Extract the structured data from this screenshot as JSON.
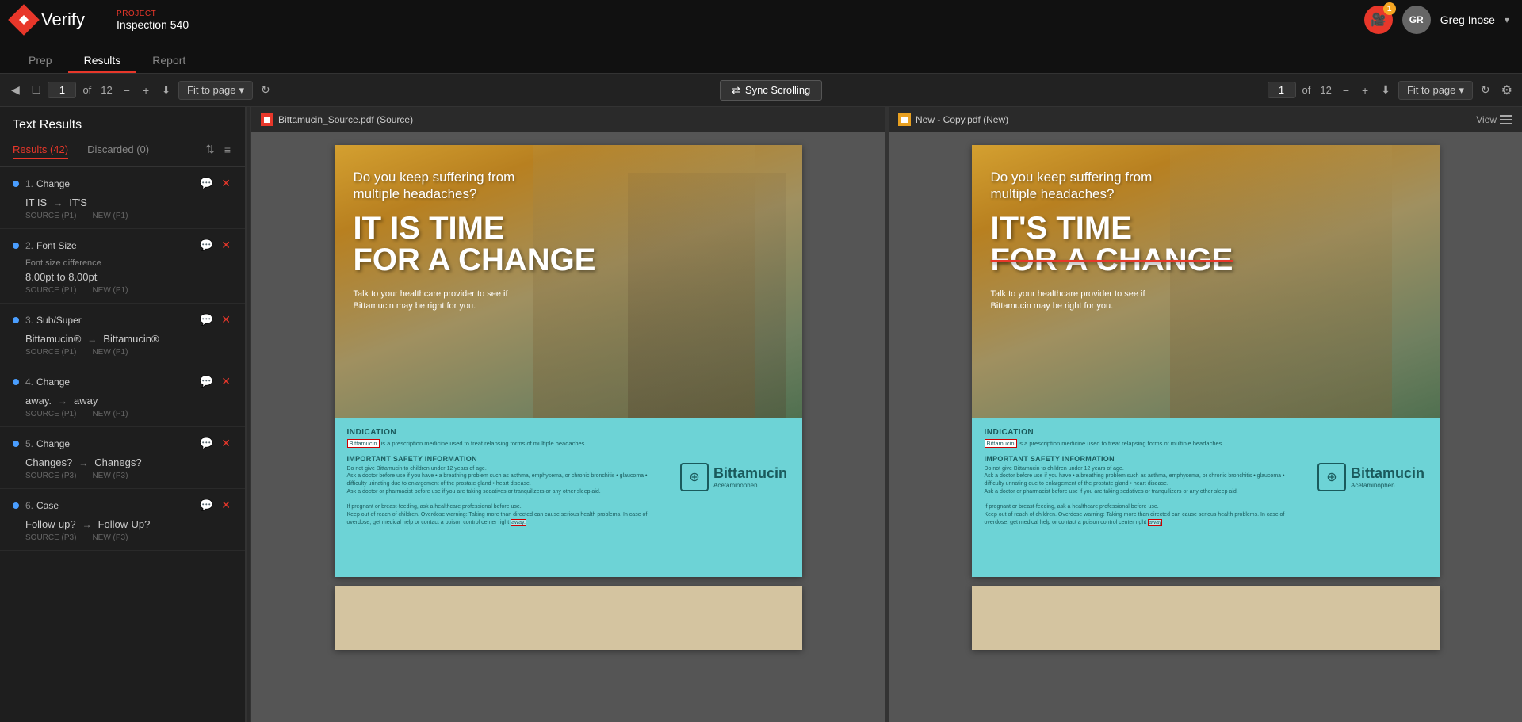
{
  "app": {
    "name": "Verify",
    "logo_alt": "Verify diamond logo"
  },
  "project": {
    "label": "PROJECT",
    "name": "Inspection 540"
  },
  "header": {
    "notification_count": "1",
    "user_initials": "GR",
    "user_name": "Greg Inose"
  },
  "tabs": [
    {
      "id": "prep",
      "label": "Prep"
    },
    {
      "id": "results",
      "label": "Results",
      "active": true
    },
    {
      "id": "report",
      "label": "Report"
    }
  ],
  "toolbar_left": {
    "prev_icon": "◀",
    "page_icon": "□",
    "page_num": "1",
    "page_total": "12",
    "minus": "−",
    "plus": "+",
    "download_icon": "⬇",
    "fit_label": "Fit to page",
    "chevron": "▾",
    "refresh_icon": "↻"
  },
  "toolbar_center": {
    "sync_icon": "⇄",
    "sync_label": "Sync Scrolling"
  },
  "toolbar_right": {
    "page_num": "1",
    "page_total": "12",
    "minus": "−",
    "plus": "+",
    "download_icon": "⬇",
    "fit_label": "Fit to page",
    "chevron": "▾",
    "refresh_icon": "↻",
    "gear_icon": "⚙"
  },
  "sidebar": {
    "title": "Text Results",
    "tabs": [
      {
        "id": "results",
        "label": "Results (42)",
        "active": true
      },
      {
        "id": "discarded",
        "label": "Discarded (0)"
      }
    ],
    "sort_icon": "⇅",
    "filter_icon": "≡",
    "results": [
      {
        "number": "1.",
        "type": "Change",
        "source_text": "IT IS",
        "new_text": "IT'S",
        "source_meta": "SOURCE (P1)",
        "new_meta": "NEW (P1)"
      },
      {
        "number": "2.",
        "type": "Font Size",
        "sub_label": "Font size difference",
        "source_text": "8.00pt to 8.00pt",
        "source_meta": "SOURCE (P1)",
        "new_meta": "NEW (P1)"
      },
      {
        "number": "3.",
        "type": "Sub/Super",
        "source_text": "Bittamucin®",
        "new_text": "Bittamucin®",
        "source_meta": "SOURCE (P1)",
        "new_meta": "NEW (P1)"
      },
      {
        "number": "4.",
        "type": "Change",
        "source_text": "away.",
        "new_text": "away",
        "source_meta": "SOURCE (P1)",
        "new_meta": "NEW (P1)"
      },
      {
        "number": "5.",
        "type": "Change",
        "source_text": "Changes?",
        "new_text": "Chanegs?",
        "source_meta": "SOURCE (P3)",
        "new_meta": "NEW (P3)"
      },
      {
        "number": "6.",
        "type": "Case",
        "source_text": "Follow-up?",
        "new_text": "Follow-Up?",
        "source_meta": "SOURCE (P3)",
        "new_meta": "NEW (P3)"
      }
    ]
  },
  "source_doc": {
    "filename": "Bittamucin_Source.pdf (Source)",
    "badge_color": "#e8372a",
    "hero_subtitle": "Do you keep suffering from multiple headaches?",
    "hero_title_line1": "IT IS TIME",
    "hero_title_line2": "FOR A CHANGE",
    "hero_tagline": "Talk to your healthcare provider to see if Bittamucin may be right for you.",
    "indication_title": "INDICATION",
    "indication_text": "Bittamucin is a prescription medicine used to treat relapsing forms of multiple headaches.",
    "safety_title": "IMPORTANT SAFETY INFORMATION",
    "safety_text": "Do not give Bittamucin to children under 12 years of age. Ask a doctor before use if you have • a breathing problem such as asthma, emphysema, or chronic bronchitis • glaucoma • difficulty urinating due to enlargement of the prostate gland • heart disease. Ask a doctor or pharmacist before use if you are taking sedatives or tranquilizers or any other sleep aid. If pregnant or breast-feeding, ask a healthcare professional before use. Keep out of reach of children. Overdose warning: Taking more than directed can cause serious health problems. In case of overdose, get medical help or contact a poison control center right away.",
    "brand_name": "Bittamucin",
    "brand_sub": "Acetaminophen"
  },
  "new_doc": {
    "filename": "New - Copy.pdf (New)",
    "badge_color": "#e8a020",
    "view_label": "View",
    "hero_subtitle": "Do you keep suffering from multiple headaches?",
    "hero_title_line1": "IT'S TIME",
    "hero_title_line2": "FOR A CHANGE",
    "hero_tagline": "Talk to your healthcare provider to see if Bittamucin may be right for you.",
    "indication_title": "INDICATION",
    "indication_text": "Bittamucin is a prescription medicine used to treat relapsing forms of multiple headaches.",
    "safety_title": "IMPORTANT SAFETY INFORMATION",
    "safety_text": "Do not give Bittamucin to children under 12 years of age. Ask a doctor before use if you have • a breathing problem such as asthma, emphysema, or chronic bronchitis • glaucoma • difficulty urinating due to enlargement of the prostate gland • heart disease. Ask a doctor or pharmacist before use if you are taking sedatives or tranquilizers or any other sleep aid. If pregnant or breast-feeding, ask a healthcare professional before use. Keep out of reach of children. Overdose warning: Taking more than directed can cause serious health problems. In case of overdose, get medical help or contact a poison control center right away.",
    "brand_name": "Bittamucin",
    "brand_sub": "Acetaminophen"
  }
}
